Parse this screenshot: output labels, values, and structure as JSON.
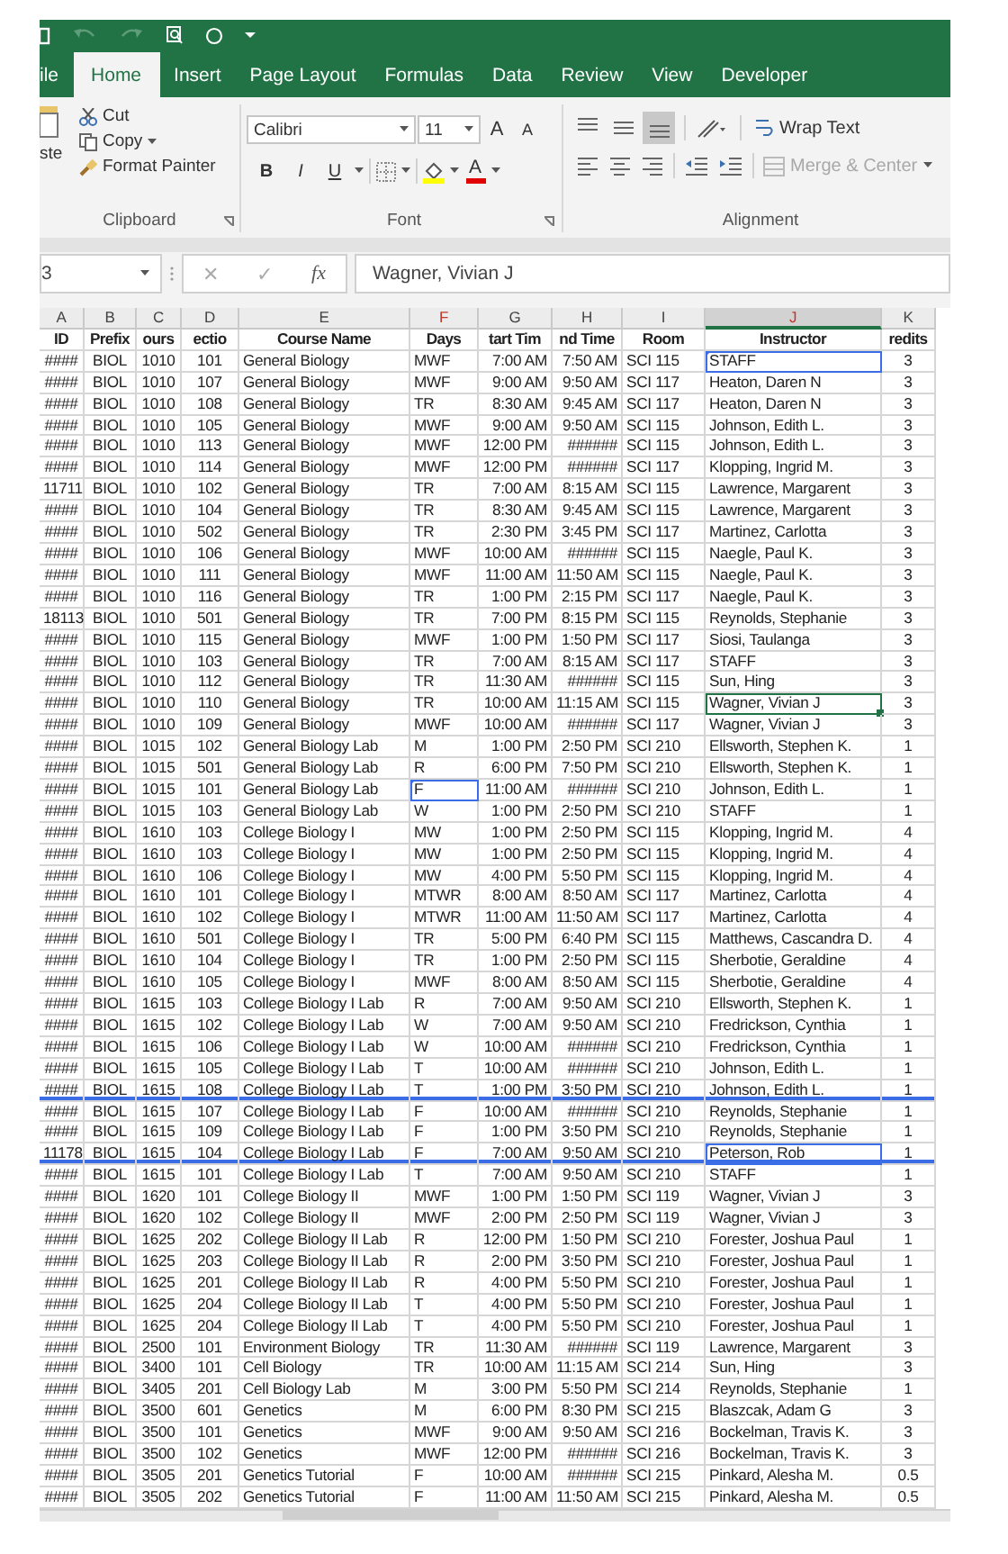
{
  "tabs": [
    {
      "label": "ile",
      "selected": false
    },
    {
      "label": "Home",
      "selected": true
    },
    {
      "label": "Insert",
      "selected": false
    },
    {
      "label": "Page Layout",
      "selected": false
    },
    {
      "label": "Formulas",
      "selected": false
    },
    {
      "label": "Data",
      "selected": false
    },
    {
      "label": "Review",
      "selected": false
    },
    {
      "label": "View",
      "selected": false
    },
    {
      "label": "Developer",
      "selected": false
    }
  ],
  "ribbon": {
    "clipboard": {
      "label": "Clipboard",
      "paste": "ste",
      "cut": "Cut",
      "copy": "Copy",
      "format_painter": "Format Painter"
    },
    "font": {
      "label": "Font",
      "font_name": "Calibri",
      "font_size": "11",
      "grow_font": "A",
      "shrink_font": "A",
      "bold": "B",
      "italic": "I",
      "underline": "U",
      "font_color": "A"
    },
    "alignment": {
      "label": "Alignment",
      "vertical_buttons": [
        {
          "kind": "top",
          "selected": false
        },
        {
          "kind": "middle",
          "selected": false
        },
        {
          "kind": "bottom",
          "selected": true
        }
      ],
      "wrap_text": "Wrap Text",
      "merge_center": {
        "label": "Merge & Center",
        "disabled": true
      }
    }
  },
  "formula_bar": {
    "name_box": "3",
    "cancel": "✕",
    "enter": "✓",
    "function": "fx",
    "value": "Wagner, Vivian J"
  },
  "sheet": {
    "columns": [
      {
        "letter": "A",
        "selected": false,
        "marked": false
      },
      {
        "letter": "B",
        "selected": false,
        "marked": false
      },
      {
        "letter": "C",
        "selected": false,
        "marked": false
      },
      {
        "letter": "D",
        "selected": false,
        "marked": false
      },
      {
        "letter": "E",
        "selected": false,
        "marked": false
      },
      {
        "letter": "F",
        "selected": false,
        "marked": true
      },
      {
        "letter": "G",
        "selected": false,
        "marked": false
      },
      {
        "letter": "H",
        "selected": false,
        "marked": false
      },
      {
        "letter": "I",
        "selected": false,
        "marked": false
      },
      {
        "letter": "J",
        "selected": true,
        "marked": true
      },
      {
        "letter": "K",
        "selected": false,
        "marked": false
      }
    ],
    "header": [
      "ID",
      "Prefix",
      "ours",
      "ectio",
      "Course Name",
      "Days",
      "tart Tim",
      "nd Time",
      "Room",
      "Instructor",
      "redits"
    ],
    "rows": [
      {
        "cells": [
          "####",
          "BIOL",
          "1010",
          "101",
          "General Biology",
          "MWF",
          "7:00 AM",
          "7:50 AM",
          "SCI 115",
          {
            "text": "STAFF",
            "outlined": true
          },
          "3"
        ],
        "rule_below": false
      },
      {
        "cells": [
          "####",
          "BIOL",
          "1010",
          "107",
          "General Biology",
          "MWF",
          "9:00 AM",
          "9:50 AM",
          "SCI 117",
          "Heaton, Daren N",
          "3"
        ],
        "rule_below": false
      },
      {
        "cells": [
          "####",
          "BIOL",
          "1010",
          "108",
          "General Biology",
          "TR",
          "8:30 AM",
          "9:45 AM",
          "SCI 117",
          "Heaton, Daren N",
          "3"
        ],
        "rule_below": false
      },
      {
        "cells": [
          "####",
          "BIOL",
          "1010",
          "105",
          "General Biology",
          "MWF",
          "9:00 AM",
          "9:50 AM",
          "SCI 115",
          "Johnson, Edith L.",
          "3"
        ],
        "rule_below": false
      },
      {
        "cells": [
          "####",
          "BIOL",
          "1010",
          "113",
          "General Biology",
          "MWF",
          "12:00 PM",
          "######",
          "SCI 115",
          "Johnson, Edith L.",
          "3"
        ],
        "rule_below": false
      },
      {
        "cells": [
          "####",
          "BIOL",
          "1010",
          "114",
          "General Biology",
          "MWF",
          "12:00 PM",
          "######",
          "SCI 117",
          "Klopping, Ingrid M.",
          "3"
        ],
        "rule_below": false
      },
      {
        "cells": [
          "11711",
          "BIOL",
          "1010",
          "102",
          "General Biology",
          "TR",
          "7:00 AM",
          "8:15 AM",
          "SCI 115",
          "Lawrence, Margarent",
          "3"
        ],
        "rule_below": false
      },
      {
        "cells": [
          "####",
          "BIOL",
          "1010",
          "104",
          "General Biology",
          "TR",
          "8:30 AM",
          "9:45 AM",
          "SCI 115",
          "Lawrence, Margarent",
          "3"
        ],
        "rule_below": false
      },
      {
        "cells": [
          "####",
          "BIOL",
          "1010",
          "502",
          "General Biology",
          "TR",
          "2:30 PM",
          "3:45 PM",
          "SCI 117",
          "Martinez, Carlotta",
          "3"
        ],
        "rule_below": false
      },
      {
        "cells": [
          "####",
          "BIOL",
          "1010",
          "106",
          "General Biology",
          "MWF",
          "10:00 AM",
          "######",
          "SCI 115",
          "Naegle, Paul K.",
          "3"
        ],
        "rule_below": false
      },
      {
        "cells": [
          "####",
          "BIOL",
          "1010",
          "111",
          "General Biology",
          "MWF",
          "11:00 AM",
          "11:50 AM",
          "SCI 115",
          "Naegle, Paul K.",
          "3"
        ],
        "rule_below": false
      },
      {
        "cells": [
          "####",
          "BIOL",
          "1010",
          "116",
          "General Biology",
          "TR",
          "1:00 PM",
          "2:15 PM",
          "SCI 117",
          "Naegle, Paul K.",
          "3"
        ],
        "rule_below": false
      },
      {
        "cells": [
          "18113",
          "BIOL",
          "1010",
          "501",
          "General Biology",
          "TR",
          "7:00 PM",
          "8:15 PM",
          "SCI 115",
          "Reynolds, Stephanie",
          "3"
        ],
        "rule_below": false
      },
      {
        "cells": [
          "####",
          "BIOL",
          "1010",
          "115",
          "General Biology",
          "MWF",
          "1:00 PM",
          "1:50 PM",
          "SCI 117",
          "Siosi, Taulanga",
          "3"
        ],
        "rule_below": false
      },
      {
        "cells": [
          "####",
          "BIOL",
          "1010",
          "103",
          "General Biology",
          "TR",
          "7:00 AM",
          "8:15 AM",
          "SCI 117",
          "STAFF",
          "3"
        ],
        "rule_below": false
      },
      {
        "cells": [
          "####",
          "BIOL",
          "1010",
          "112",
          "General Biology",
          "TR",
          "11:30 AM",
          "######",
          "SCI 115",
          "Sun, Hing",
          "3"
        ],
        "rule_below": false
      },
      {
        "cells": [
          "####",
          "BIOL",
          "1010",
          "110",
          "General Biology",
          "TR",
          "10:00 AM",
          "11:15 AM",
          "SCI 115",
          {
            "text": "Wagner, Vivian J",
            "active": true
          },
          "3"
        ],
        "rule_below": false
      },
      {
        "cells": [
          "####",
          "BIOL",
          "1010",
          "109",
          "General Biology",
          "MWF",
          "10:00 AM",
          "######",
          "SCI 117",
          "Wagner, Vivian J",
          "3"
        ],
        "rule_below": false
      },
      {
        "cells": [
          "####",
          "BIOL",
          "1015",
          "102",
          "General Biology Lab",
          "M",
          "1:00 PM",
          "2:50 PM",
          "SCI 210",
          "Ellsworth, Stephen K.",
          "1"
        ],
        "rule_below": false
      },
      {
        "cells": [
          "####",
          "BIOL",
          "1015",
          "501",
          "General Biology Lab",
          "R",
          "6:00 PM",
          "7:50 PM",
          "SCI 210",
          "Ellsworth, Stephen K.",
          "1"
        ],
        "rule_below": false
      },
      {
        "cells": [
          "####",
          "BIOL",
          "1015",
          "101",
          "General Biology Lab",
          {
            "text": "F",
            "outlined": true
          },
          "11:00 AM",
          "######",
          "SCI 210",
          "Johnson, Edith L.",
          "1"
        ],
        "rule_below": false
      },
      {
        "cells": [
          "####",
          "BIOL",
          "1015",
          "103",
          "General Biology Lab",
          "W",
          "1:00 PM",
          "2:50 PM",
          "SCI 210",
          "STAFF",
          "1"
        ],
        "rule_below": false
      },
      {
        "cells": [
          "####",
          "BIOL",
          "1610",
          "103",
          "College Biology I",
          "MW",
          "1:00 PM",
          "2:50 PM",
          "SCI 115",
          "Klopping, Ingrid M.",
          "4"
        ],
        "rule_below": false
      },
      {
        "cells": [
          "####",
          "BIOL",
          "1610",
          "103",
          "College Biology I",
          "MW",
          "1:00 PM",
          "2:50 PM",
          "SCI 115",
          "Klopping, Ingrid M.",
          "4"
        ],
        "rule_below": false
      },
      {
        "cells": [
          "####",
          "BIOL",
          "1610",
          "106",
          "College Biology I",
          "MW",
          "4:00 PM",
          "5:50 PM",
          "SCI 115",
          "Klopping, Ingrid M.",
          "4"
        ],
        "rule_below": false
      },
      {
        "cells": [
          "####",
          "BIOL",
          "1610",
          "101",
          "College Biology I",
          "MTWR",
          "8:00 AM",
          "8:50 AM",
          "SCI 117",
          "Martinez, Carlotta",
          "4"
        ],
        "rule_below": false
      },
      {
        "cells": [
          "####",
          "BIOL",
          "1610",
          "102",
          "College Biology I",
          "MTWR",
          "11:00 AM",
          "11:50 AM",
          "SCI 117",
          "Martinez, Carlotta",
          "4"
        ],
        "rule_below": false
      },
      {
        "cells": [
          "####",
          "BIOL",
          "1610",
          "501",
          "College Biology I",
          "TR",
          "5:00 PM",
          "6:40 PM",
          "SCI 115",
          "Matthews, Cascandra D.",
          "4"
        ],
        "rule_below": false
      },
      {
        "cells": [
          "####",
          "BIOL",
          "1610",
          "104",
          "College Biology I",
          "TR",
          "1:00 PM",
          "2:50 PM",
          "SCI 115",
          "Sherbotie, Geraldine",
          "4"
        ],
        "rule_below": false
      },
      {
        "cells": [
          "####",
          "BIOL",
          "1610",
          "105",
          "College Biology I",
          "MWF",
          "8:00 AM",
          "8:50 AM",
          "SCI 115",
          "Sherbotie, Geraldine",
          "4"
        ],
        "rule_below": false
      },
      {
        "cells": [
          "####",
          "BIOL",
          "1615",
          "103",
          "College Biology I Lab",
          "R",
          "7:00 AM",
          "9:50 AM",
          "SCI 210",
          "Ellsworth, Stephen K.",
          "1"
        ],
        "rule_below": false
      },
      {
        "cells": [
          "####",
          "BIOL",
          "1615",
          "102",
          "College Biology I Lab",
          "W",
          "7:00 AM",
          "9:50 AM",
          "SCI 210",
          "Fredrickson, Cynthia",
          "1"
        ],
        "rule_below": false
      },
      {
        "cells": [
          "####",
          "BIOL",
          "1615",
          "106",
          "College Biology I Lab",
          "W",
          "10:00 AM",
          "######",
          "SCI 210",
          "Fredrickson, Cynthia",
          "1"
        ],
        "rule_below": false
      },
      {
        "cells": [
          "####",
          "BIOL",
          "1615",
          "105",
          "College Biology I Lab",
          "T",
          "10:00 AM",
          "######",
          "SCI 210",
          "Johnson, Edith L.",
          "1"
        ],
        "rule_below": false
      },
      {
        "cells": [
          "####",
          "BIOL",
          "1615",
          "108",
          "College Biology I Lab",
          "T",
          "1:00 PM",
          "3:50 PM",
          "SCI 210",
          "Johnson, Edith L.",
          "1"
        ],
        "rule_below": true
      },
      {
        "cells": [
          "####",
          "BIOL",
          "1615",
          "107",
          "College Biology I Lab",
          "F",
          "10:00 AM",
          "######",
          "SCI 210",
          "Reynolds, Stephanie",
          "1"
        ],
        "rule_below": false
      },
      {
        "cells": [
          "####",
          "BIOL",
          "1615",
          "109",
          "College Biology I Lab",
          "F",
          "1:00 PM",
          "3:50 PM",
          "SCI 210",
          "Reynolds, Stephanie",
          "1"
        ],
        "rule_below": false
      },
      {
        "cells": [
          "11178",
          "BIOL",
          "1615",
          "104",
          "College Biology I Lab",
          "F",
          "7:00 AM",
          "9:50 AM",
          "SCI 210",
          {
            "text": "Peterson, Rob",
            "outlined": true
          },
          "1"
        ],
        "rule_below": true
      },
      {
        "cells": [
          "####",
          "BIOL",
          "1615",
          "101",
          "College Biology I Lab",
          "T",
          "7:00 AM",
          "9:50 AM",
          "SCI 210",
          "STAFF",
          "1"
        ],
        "rule_below": false
      },
      {
        "cells": [
          "####",
          "BIOL",
          "1620",
          "101",
          "College Biology II",
          "MWF",
          "1:00 PM",
          "1:50 PM",
          "SCI 119",
          "Wagner, Vivian J",
          "3"
        ],
        "rule_below": false
      },
      {
        "cells": [
          "####",
          "BIOL",
          "1620",
          "102",
          "College Biology II",
          "MWF",
          "2:00 PM",
          "2:50 PM",
          "SCI 119",
          "Wagner, Vivian J",
          "3"
        ],
        "rule_below": false
      },
      {
        "cells": [
          "####",
          "BIOL",
          "1625",
          "202",
          "College Biology II Lab",
          "R",
          "12:00 PM",
          "1:50 PM",
          "SCI 210",
          "Forester, Joshua Paul",
          "1"
        ],
        "rule_below": false
      },
      {
        "cells": [
          "####",
          "BIOL",
          "1625",
          "203",
          "College Biology II Lab",
          "R",
          "2:00 PM",
          "3:50 PM",
          "SCI 210",
          "Forester, Joshua Paul",
          "1"
        ],
        "rule_below": false
      },
      {
        "cells": [
          "####",
          "BIOL",
          "1625",
          "201",
          "College Biology II Lab",
          "R",
          "4:00 PM",
          "5:50 PM",
          "SCI 210",
          "Forester, Joshua Paul",
          "1"
        ],
        "rule_below": false
      },
      {
        "cells": [
          "####",
          "BIOL",
          "1625",
          "204",
          "College Biology II Lab",
          "T",
          "4:00 PM",
          "5:50 PM",
          "SCI 210",
          "Forester, Joshua Paul",
          "1"
        ],
        "rule_below": false
      },
      {
        "cells": [
          "####",
          "BIOL",
          "1625",
          "204",
          "College Biology II Lab",
          "T",
          "4:00 PM",
          "5:50 PM",
          "SCI 210",
          "Forester, Joshua Paul",
          "1"
        ],
        "rule_below": false
      },
      {
        "cells": [
          "####",
          "BIOL",
          "2500",
          "101",
          "Environment Biology",
          "TR",
          "11:30 AM",
          "######",
          "SCI 119",
          "Lawrence, Margarent",
          "3"
        ],
        "rule_below": false
      },
      {
        "cells": [
          "####",
          "BIOL",
          "3400",
          "101",
          "Cell Biology",
          "TR",
          "10:00 AM",
          "11:15 AM",
          "SCI 214",
          "Sun, Hing",
          "3"
        ],
        "rule_below": false
      },
      {
        "cells": [
          "####",
          "BIOL",
          "3405",
          "201",
          "Cell Biology Lab",
          "M",
          "3:00 PM",
          "5:50 PM",
          "SCI 214",
          "Reynolds, Stephanie",
          "1"
        ],
        "rule_below": false
      },
      {
        "cells": [
          "####",
          "BIOL",
          "3500",
          "601",
          "Genetics",
          "M",
          "6:00 PM",
          "8:30 PM",
          "SCI 215",
          "Blaszcak, Adam G",
          "3"
        ],
        "rule_below": false
      },
      {
        "cells": [
          "####",
          "BIOL",
          "3500",
          "101",
          "Genetics",
          "MWF",
          "9:00 AM",
          "9:50 AM",
          "SCI 216",
          "Bockelman, Travis K.",
          "3"
        ],
        "rule_below": false
      },
      {
        "cells": [
          "####",
          "BIOL",
          "3500",
          "102",
          "Genetics",
          "MWF",
          "12:00 PM",
          "######",
          "SCI 216",
          "Bockelman, Travis K.",
          "3"
        ],
        "rule_below": false
      },
      {
        "cells": [
          "####",
          "BIOL",
          "3505",
          "201",
          "Genetics Tutorial",
          "F",
          "10:00 AM",
          "######",
          "SCI 215",
          "Pinkard, Alesha M.",
          "0.5"
        ],
        "rule_below": false
      },
      {
        "cells": [
          "####",
          "BIOL",
          "3505",
          "202",
          "Genetics Tutorial",
          "F",
          "11:00 AM",
          "11:50 AM",
          "SCI 215",
          "Pinkard, Alesha M.",
          "0.5"
        ],
        "rule_below": false
      }
    ]
  }
}
